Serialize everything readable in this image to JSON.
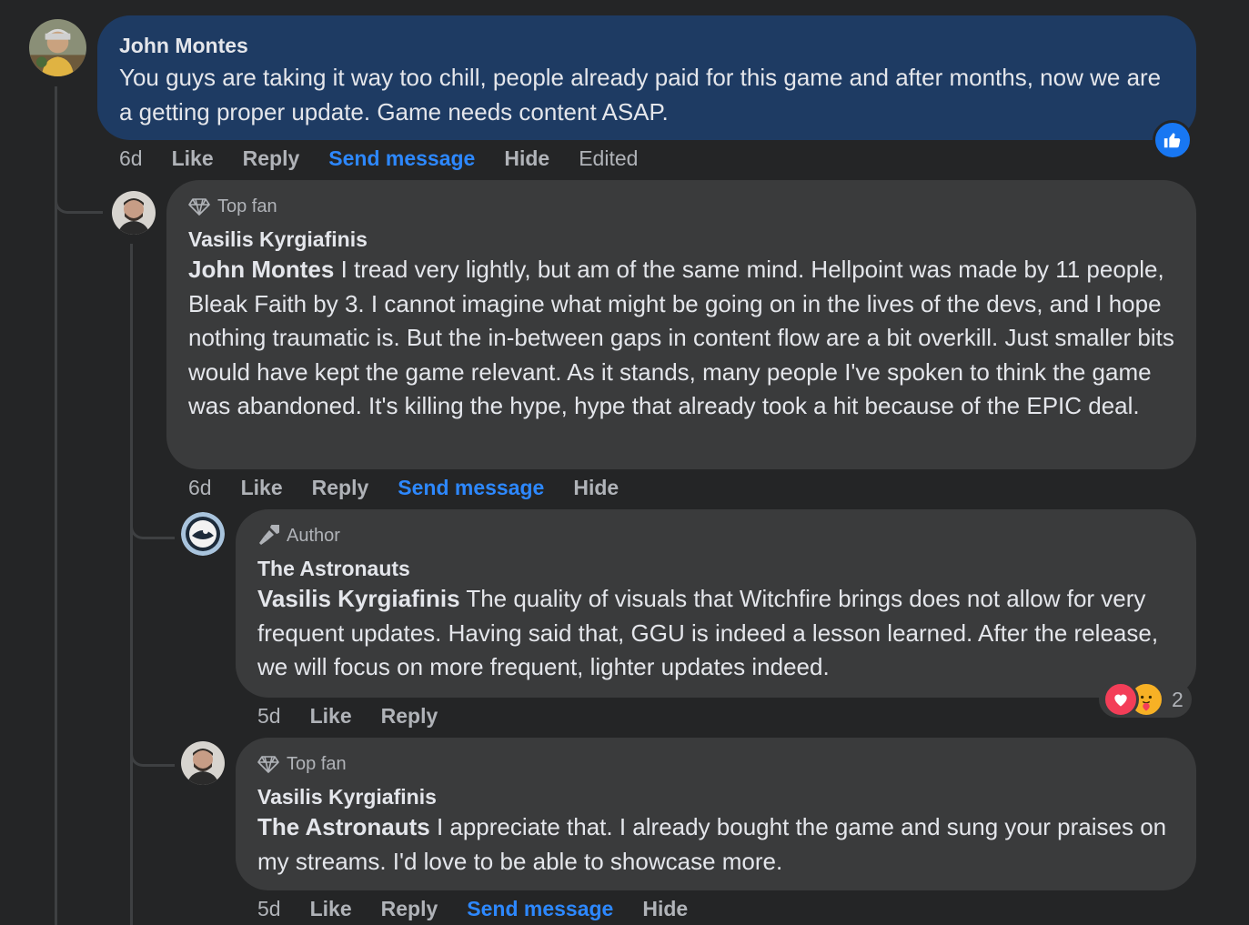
{
  "comments": [
    {
      "author": "John Montes",
      "text": "You guys are taking it way too chill, people already paid for this game and after months, now we are a getting proper update. Game needs content ASAP.",
      "actions": {
        "time": "6d",
        "like": "Like",
        "reply": "Reply",
        "send_message": "Send message",
        "hide": "Hide",
        "edited": "Edited"
      },
      "reaction": {
        "type": "like-icon"
      }
    },
    {
      "badge": "Top fan",
      "author": "Vasilis Kyrgiafinis",
      "mention": "John Montes",
      "text": " I tread very lightly, but am of the same mind. Hellpoint was made by 11 people, Bleak Faith by 3. I cannot imagine what might be going on in the lives of the devs, and I hope nothing traumatic is. But the in-between gaps in content flow are a bit overkill. Just smaller bits would have kept the game relevant. As it stands, many people I've spoken to think the game was abandoned. It's killing the hype, hype that already took a hit because of the EPIC deal.",
      "actions": {
        "time": "6d",
        "like": "Like",
        "reply": "Reply",
        "send_message": "Send message",
        "hide": "Hide"
      }
    },
    {
      "badge": "Author",
      "author": "The Astronauts",
      "mention": "Vasilis Kyrgiafinis",
      "text": " The quality of visuals that Witchfire brings does not allow for very frequent updates. Having said that, GGU is indeed a lesson learned. After the release, we will focus on more frequent, lighter updates indeed.",
      "actions": {
        "time": "5d",
        "like": "Like",
        "reply": "Reply"
      },
      "reactions": {
        "icons": [
          "love-icon",
          "care-icon"
        ],
        "count": "2"
      }
    },
    {
      "badge": "Top fan",
      "author": "Vasilis Kyrgiafinis",
      "mention": "The Astronauts",
      "text": " I appreciate that. I already bought the game and sung your praises on my streams. I'd love to be able to showcase more.",
      "actions": {
        "time": "5d",
        "like": "Like",
        "reply": "Reply",
        "send_message": "Send message",
        "hide": "Hide"
      }
    }
  ],
  "colors": {
    "background": "#242526",
    "highlight_bubble": "#1e3b63",
    "bubble": "#3a3b3c",
    "link": "#2d88ff",
    "like_blue": "#1877f2",
    "love_red": "#f33e58"
  }
}
